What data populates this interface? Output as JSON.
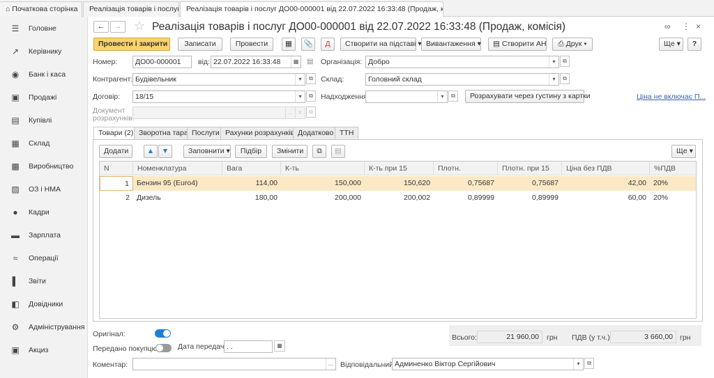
{
  "tabs": [
    {
      "label": "Початкова сторінка",
      "home": true
    },
    {
      "label": "Реалізація товарів і послуг",
      "closable": true
    },
    {
      "label": "Реалізація товарів і послуг ДО00-000001 від 22.07.2022 16:33:48 (Продаж, комісія)",
      "closable": true,
      "active": true
    }
  ],
  "sidebar": {
    "items": [
      {
        "label": "Головне",
        "icon": "menu-icon"
      },
      {
        "label": "Керівнику",
        "icon": "chart-icon"
      },
      {
        "label": "Банк і каса",
        "icon": "bank-icon"
      },
      {
        "label": "Продажі",
        "icon": "bag-icon"
      },
      {
        "label": "Купівлі",
        "icon": "cart-icon"
      },
      {
        "label": "Склад",
        "icon": "warehouse-icon"
      },
      {
        "label": "Виробництво",
        "icon": "factory-icon"
      },
      {
        "label": "ОЗ і НМА",
        "icon": "truck-icon"
      },
      {
        "label": "Кадри",
        "icon": "person-icon"
      },
      {
        "label": "Зарплата",
        "icon": "wallet-icon"
      },
      {
        "label": "Операції",
        "icon": "operations-icon"
      },
      {
        "label": "Звіти",
        "icon": "report-icon"
      },
      {
        "label": "Довідники",
        "icon": "book-icon"
      },
      {
        "label": "Адміністрування",
        "icon": "gear-icon"
      },
      {
        "label": "Акциз",
        "icon": "excise-icon"
      }
    ]
  },
  "header": {
    "title": "Реалізація товарів і послуг ДО00-000001 від 22.07.2022 16:33:48 (Продаж, комісія)"
  },
  "toolbar": {
    "post_close": "Провести і закрити",
    "save": "Записати",
    "post": "Провести",
    "create_based": "Створити на підставі",
    "export": "Вивантаження",
    "create_ah": "Створити АН",
    "print": "Друк",
    "more": "Ще",
    "help": "?"
  },
  "form": {
    "number_label": "Номер:",
    "number": "ДО00-000001",
    "date_label": "від:",
    "date": "22.07.2022 16:33:48",
    "org_label": "Організація:",
    "org": "Добро",
    "counterparty_label": "Контрагент:",
    "counterparty": "Будівельник",
    "warehouse_label": "Склад:",
    "warehouse": "Головний склад",
    "contract_label": "Договір:",
    "contract": "18/15",
    "receipt_label": "Надходження:",
    "receipt": "",
    "calc_density": "Розрахувати через густину з картки",
    "vat_link": "Ціна не включає П...",
    "settlement_label_1": "Документ",
    "settlement_label_2": "розрахунків:",
    "settlement": ""
  },
  "doc_tabs": [
    "Товари (2)",
    "Зворотна тара",
    "Послуги",
    "Рахунки розрахунків",
    "Додатково",
    "ТТН"
  ],
  "grid_toolbar": {
    "add": "Додати",
    "fill": "Заповнити",
    "select": "Підбір",
    "change": "Змінити",
    "more": "Ще"
  },
  "grid": {
    "columns": [
      "N",
      "Номенклатура",
      "Вага",
      "К-ть",
      "К-ть при 15",
      "Плотн.",
      "Плотн. при 15",
      "Ціна без ПДВ",
      "%ПДВ"
    ],
    "rows": [
      {
        "n": "1",
        "name": "Бензин 95 (Euro4)",
        "weight": "114,00",
        "qty": "150,000",
        "qty15": "150,620",
        "dens": "0,75687",
        "dens15": "0,75687",
        "price": "42,00",
        "vat": "20%"
      },
      {
        "n": "2",
        "name": "Дизель",
        "weight": "180,00",
        "qty": "200,000",
        "qty15": "200,002",
        "dens": "0,89999",
        "dens15": "0,89999",
        "price": "60,00",
        "vat": "20%"
      }
    ]
  },
  "footer": {
    "original_label": "Оригінал:",
    "handed_label": "Передано покупцю:",
    "transfer_date_label": "Дата передачі:",
    "transfer_date": " .  .",
    "total_label": "Всього:",
    "total": "21 960,00",
    "currency": "грн",
    "vat_label": "ПДВ (у т.ч.):",
    "vat_total": "3 660,00",
    "comment_label": "Коментар:",
    "comment": "",
    "responsible_label": "Відповідальний:",
    "responsible": "Админенко Віктор Сергійович"
  }
}
